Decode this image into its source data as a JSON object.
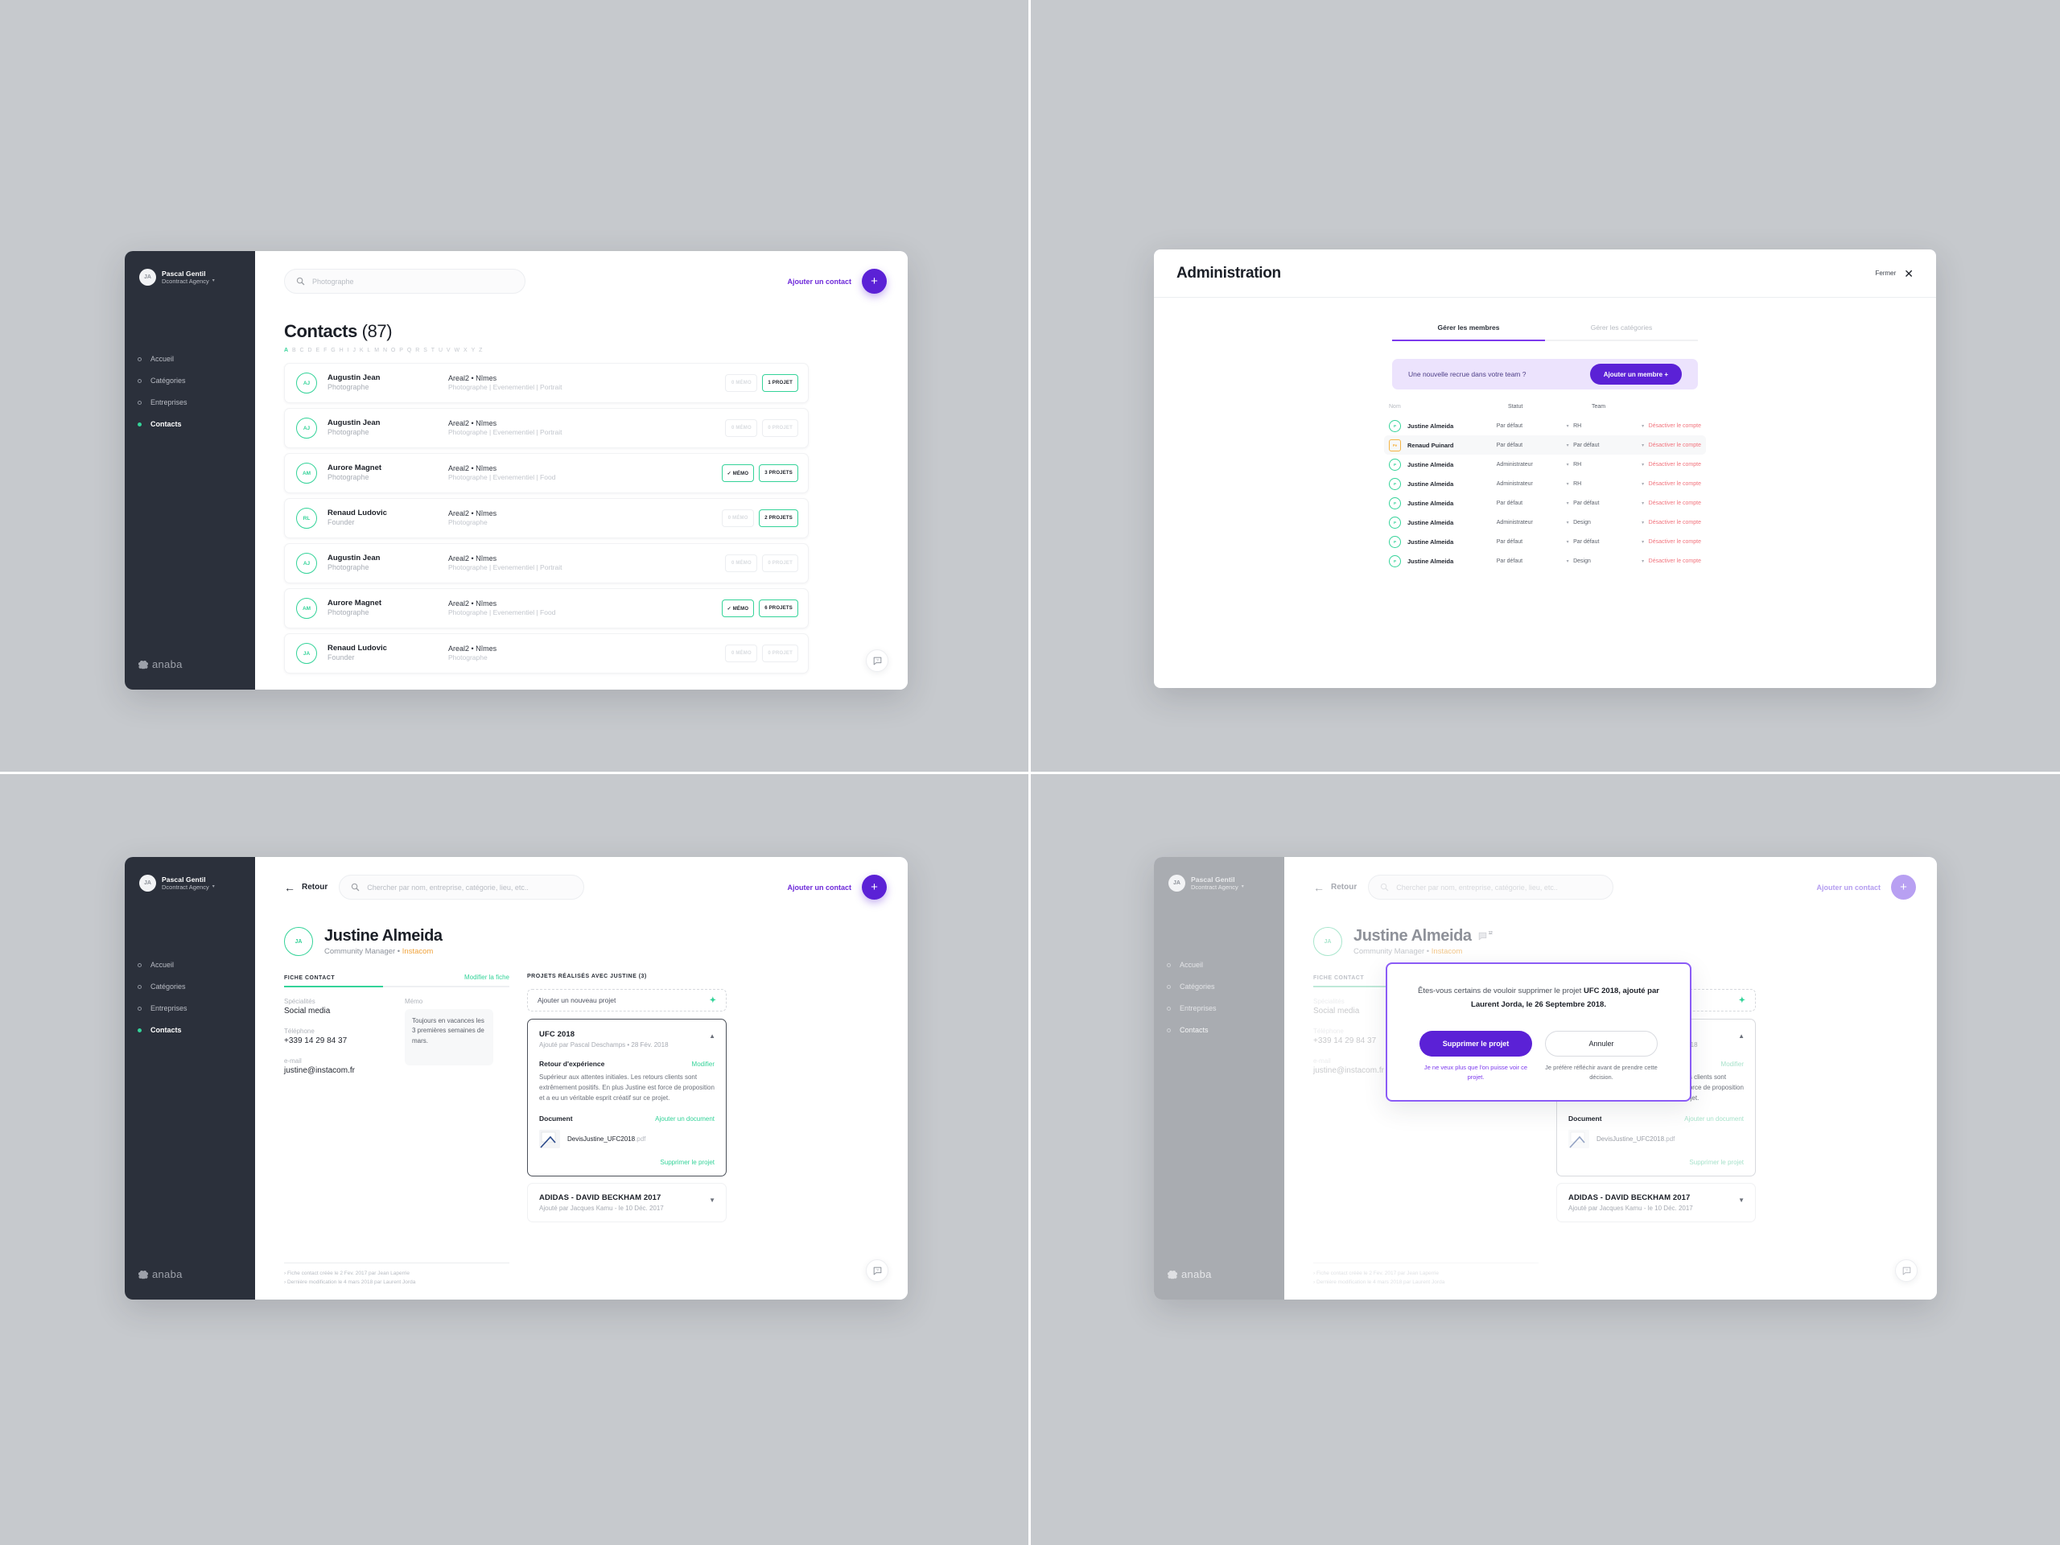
{
  "app": {
    "logo": "anaba",
    "accent_purple": "#5b21d6",
    "accent_green": "#34d399",
    "accent_orange": "#f0a33c",
    "danger": "#f2737d",
    "sidebar_bg": "#2b303b",
    "page_bg": "#c6c9cd"
  },
  "sidebar": {
    "user": {
      "initials": "JA",
      "name": "Pascal Gentil",
      "org": "Dcontract Agency"
    },
    "items": [
      {
        "label": "Accueil",
        "active": false
      },
      {
        "label": "Catégories",
        "active": false
      },
      {
        "label": "Entreprises",
        "active": false
      },
      {
        "label": "Contacts",
        "active": true
      }
    ]
  },
  "contacts_page": {
    "search": {
      "placeholder": "Photographe",
      "icon": "search-icon"
    },
    "add_contact_label": "Ajouter un contact",
    "fab_icon": "plus-icon",
    "title": "Contacts",
    "count": "(87)",
    "alphabet": [
      "A",
      "B",
      "C",
      "D",
      "E",
      "F",
      "G",
      "H",
      "I",
      "J",
      "K",
      "L",
      "M",
      "N",
      "O",
      "P",
      "Q",
      "R",
      "S",
      "T",
      "U",
      "V",
      "W",
      "X",
      "Y",
      "Z"
    ],
    "active_letter": "A",
    "rows": [
      {
        "initials": "AJ",
        "name": "Augustin Jean",
        "role": "Photographe",
        "org": "Areal2 • Nîmes",
        "tags": "Photographe | Evenementiel | Portrait",
        "memo": "0 MÉMO",
        "memo_on": false,
        "projects": "1 PROJET",
        "projects_on": true
      },
      {
        "initials": "AJ",
        "name": "Augustin Jean",
        "role": "Photographe",
        "org": "Areal2 • Nîmes",
        "tags": "Photographe | Evenementiel | Portrait",
        "memo": "0 MÉMO",
        "memo_on": false,
        "projects": "0 PROJET",
        "projects_on": false
      },
      {
        "initials": "AM",
        "name": "Aurore Magnet",
        "role": "Photographe",
        "org": "Areal2 • Nîmes",
        "tags": "Photographe | Evenementiel | Food",
        "memo": "✓ MÉMO",
        "memo_on": true,
        "projects": "3 PROJETS",
        "projects_on": true
      },
      {
        "initials": "RL",
        "name": "Renaud Ludovic",
        "role": "Founder",
        "org": "Areal2 • Nîmes",
        "tags": "Photographe",
        "memo": "0 MÉMO",
        "memo_on": false,
        "projects": "2 PROJETS",
        "projects_on": true
      },
      {
        "initials": "AJ",
        "name": "Augustin Jean",
        "role": "Photographe",
        "org": "Areal2 • Nîmes",
        "tags": "Photographe | Evenementiel | Portrait",
        "memo": "0 MÉMO",
        "memo_on": false,
        "projects": "0 PROJET",
        "projects_on": false
      },
      {
        "initials": "AM",
        "name": "Aurore Magnet",
        "role": "Photographe",
        "org": "Areal2 • Nîmes",
        "tags": "Photographe | Evenementiel | Food",
        "memo": "✓ MÉMO",
        "memo_on": true,
        "projects": "6 PROJETS",
        "projects_on": true
      },
      {
        "initials": "JA",
        "name": "Renaud Ludovic",
        "role": "Founder",
        "org": "Areal2 • Nîmes",
        "tags": "Photographe",
        "memo": "0 MÉMO",
        "memo_on": false,
        "projects": "0 PROJET",
        "projects_on": false
      }
    ]
  },
  "admin": {
    "title": "Administration",
    "close_label": "Fermer",
    "close_icon": "close-icon",
    "tabs": [
      {
        "label": "Gérer les membres",
        "active": true
      },
      {
        "label": "Gérer les catégories",
        "active": false
      }
    ],
    "cta": {
      "text": "Une nouvelle recrue dans votre team ?",
      "button": "Ajouter un membre +"
    },
    "columns": {
      "name": "Nom",
      "status": "Statut",
      "team": "Team"
    },
    "action_label": "Désactiver le compte",
    "members": [
      {
        "initials": "P",
        "name": "Justine Almeida",
        "status": "Par défaut",
        "team": "RH",
        "pending": false,
        "highlight": false
      },
      {
        "initials": "Pe",
        "name": "Renaud Puinard",
        "status": "Par défaut",
        "team": "Par défaut",
        "pending": true,
        "highlight": true
      },
      {
        "initials": "P",
        "name": "Justine Almeida",
        "status": "Administrateur",
        "team": "RH",
        "pending": false,
        "highlight": false
      },
      {
        "initials": "P",
        "name": "Justine Almeida",
        "status": "Administrateur",
        "team": "RH",
        "pending": false,
        "highlight": false
      },
      {
        "initials": "P",
        "name": "Justine Almeida",
        "status": "Par défaut",
        "team": "Par défaut",
        "pending": false,
        "highlight": false
      },
      {
        "initials": "P",
        "name": "Justine Almeida",
        "status": "Administrateur",
        "team": "Design",
        "pending": false,
        "highlight": false
      },
      {
        "initials": "P",
        "name": "Justine Almeida",
        "status": "Par défaut",
        "team": "Par défaut",
        "pending": false,
        "highlight": false
      },
      {
        "initials": "P",
        "name": "Justine Almeida",
        "status": "Par défaut",
        "team": "Design",
        "pending": false,
        "highlight": false
      }
    ]
  },
  "detail_page": {
    "back_label": "Retour",
    "search": {
      "placeholder": "Chercher par nom, entreprise, catégorie, lieu, etc..",
      "icon": "search-icon"
    },
    "add_contact_label": "Ajouter un contact",
    "contact": {
      "initials": "JA",
      "name": "Justine Almeida",
      "role": "Community Manager",
      "separator": " • ",
      "company": "Instacom",
      "memo_badge": "12"
    },
    "left_col": {
      "header": "FICHE CONTACT",
      "edit_link": "Modifier la fiche",
      "specialites_label": "Spécialités",
      "specialites_value": "Social media",
      "telephone_label": "Téléphone",
      "telephone_value": "+339 14 29 84 37",
      "email_label": "e-mail",
      "email_value": "justine@instacom.fr",
      "memo_label": "Mémo",
      "memo_value": "Toujours en vacances les 3 premières semaines de mars."
    },
    "right_col": {
      "header": "PROJETS RÉALISÉS AVEC JUSTINE (3)",
      "add_project": "Ajouter un nouveau projet",
      "add_project_icon": "plus-icon",
      "project": {
        "title": "UFC 2018",
        "meta": "Ajouté par Pascal Deschamps • 28 Fév. 2018",
        "collapse_icon": "chevron-up-icon",
        "feedback_label": "Retour d'expérience",
        "feedback_edit": "Modifier",
        "feedback_body": "Supérieur aux attentes initiales. Les retours clients sont extrêmement positifs. En plus Justine est force de proposition et a eu un véritable esprit créatif sur ce projet.",
        "document_label": "Document",
        "document_add": "Ajouter un document",
        "document_name": "DevisJustine_UFC2018",
        "document_ext": ".pdf",
        "delete_link": "Supprimer le projet"
      },
      "project_collapsed": {
        "title": "ADIDAS - DAVID BECKHAM 2017",
        "meta": "Ajouté par Jacques Kamu - le 10 Déc. 2017",
        "expand_icon": "chevron-down-icon"
      }
    },
    "footer": {
      "line1": "› Fiche contact créée le 2 Fev. 2017 par Jean Laperrie",
      "line2": "› Dernière modification le 4 mars 2018 par Laurent Jorda"
    },
    "help_icon": "help-chat-icon"
  },
  "delete_modal": {
    "question_prefix": "Êtes-vous certains de vouloir supprimer le projet ",
    "question_bold": "UFC 2018, ajouté par Laurent Jorda, le 26 Septembre 2018.",
    "confirm_button": "Supprimer le projet",
    "confirm_caption": "Je ne veux plus que l'on puisse voir ce projet.",
    "cancel_button": "Annuler",
    "cancel_caption": "Je préfère réfléchir avant de prendre cette décision."
  }
}
